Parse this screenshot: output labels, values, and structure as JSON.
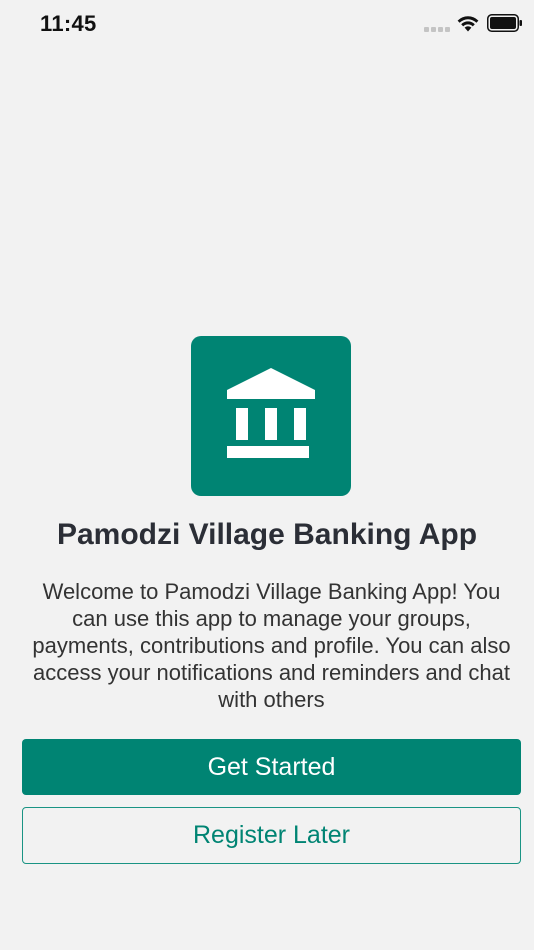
{
  "status_bar": {
    "time": "11:45"
  },
  "icons": {
    "signal": "signal-dots-icon",
    "wifi": "wifi-icon",
    "battery": "battery-icon",
    "logo": "bank-building-icon"
  },
  "colors": {
    "brand": "#008473",
    "background": "#f2f2f2",
    "title_text": "#2b2e36"
  },
  "welcome": {
    "title": "Pamodzi Village Banking App",
    "description": "Welcome to Pamodzi Village Banking App! You can use this app to manage your groups, payments, contributions and profile. You can also access your notifications and reminders and chat with others"
  },
  "actions": {
    "get_started_label": "Get Started",
    "register_later_label": "Register Later"
  }
}
